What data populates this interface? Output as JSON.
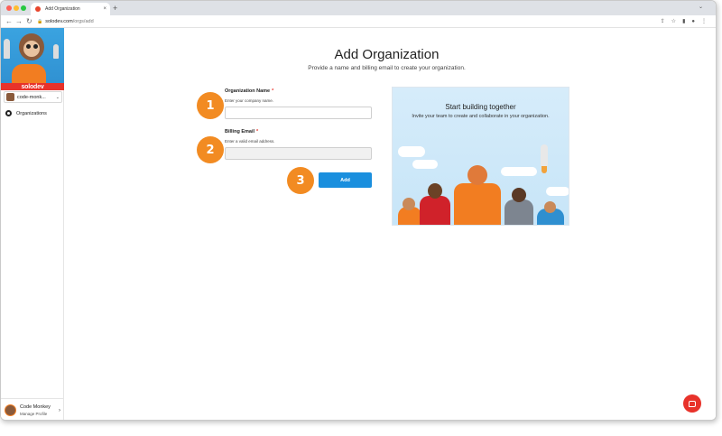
{
  "browser": {
    "tab_title": "Add Organization",
    "tab_close": "×",
    "new_tab": "+",
    "url_host": "solodev.com",
    "url_path": "/orgs/add"
  },
  "sidebar": {
    "brand": "solodev",
    "org_name": "code-monk...",
    "nav_items": [
      {
        "label": "Organizations",
        "icon": "organizations-icon"
      }
    ],
    "profile": {
      "name": "Code Monkey",
      "subtitle": "Manage Profile"
    }
  },
  "page": {
    "title": "Add Organization",
    "subtitle": "Provide a name and billing email to create your organization."
  },
  "form": {
    "org_name": {
      "label": "Organization Name",
      "required_marker": "*",
      "hint": "Enter your company name.",
      "value": ""
    },
    "billing_email": {
      "label": "Billing Email",
      "required_marker": "*",
      "hint": "Enter a valid email address.",
      "value": ""
    },
    "submit_label": "Add"
  },
  "steps": [
    "1",
    "2",
    "3"
  ],
  "promo": {
    "title": "Start building together",
    "text": "Invite your team to create and collaborate in your organization."
  },
  "colors": {
    "accent": "#1a8fde",
    "step_badge": "#f28b22",
    "brand_red": "#e8322a"
  }
}
